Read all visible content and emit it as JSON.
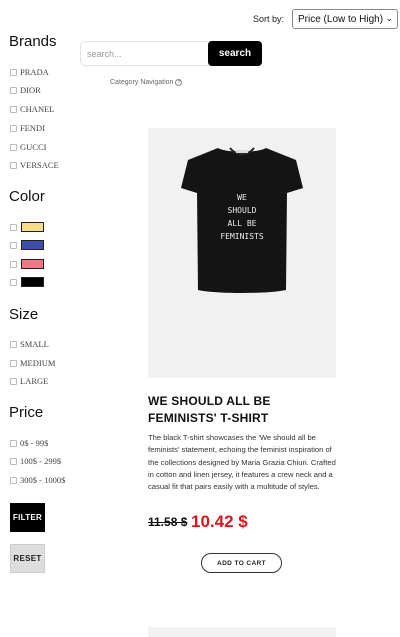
{
  "sort": {
    "label": "Sort by:",
    "selected": "Price (Low to High)"
  },
  "search": {
    "placeholder": "search...",
    "button": "search"
  },
  "category_nav": {
    "label": "Category Navigation"
  },
  "filters": {
    "brands": {
      "title": "Brands",
      "options": [
        "PRADA",
        "DIOR",
        "CHANEL",
        "FENDI",
        "GUCCI",
        "VERSACE"
      ]
    },
    "color": {
      "title": "Color",
      "swatches": [
        "#f5de86",
        "#3f4ea6",
        "#f07784",
        "#000000"
      ]
    },
    "size": {
      "title": "Size",
      "options": [
        "SMALL",
        "MEDIUM",
        "LARGE"
      ]
    },
    "price": {
      "title": "Price",
      "options": [
        "0$ - 99$",
        "100$ - 299$",
        "300$ - 1000$"
      ]
    },
    "filter_button": "FILTER",
    "reset_button": "RESET"
  },
  "product": {
    "shirt_text": [
      "WE",
      "SHOULD",
      "ALL BE",
      "FEMINISTS"
    ],
    "title": "WE SHOULD ALL BE FEMINISTS' T-SHIRT",
    "description": "The black T-shirt showcases the 'We should all be feminists' statement, echoing the feminist inspiration of the collections designed by Maria Grazia Chiuri. Crafted in cotton and linen jersey, it features a crew neck and a casual fit that pairs easily with a multitude of styles.",
    "old_price": "11.58 $",
    "new_price": "10.42 $",
    "cart_button": "ADD TO CART"
  }
}
